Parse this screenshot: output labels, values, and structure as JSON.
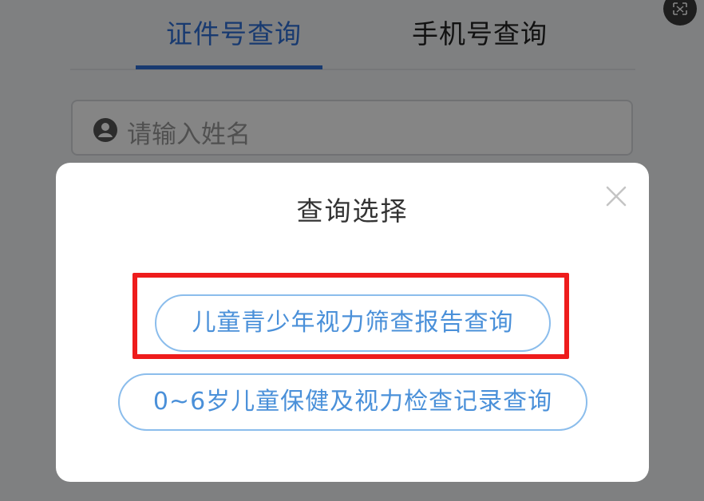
{
  "tabs": [
    {
      "label": "证件号查询",
      "active": true
    },
    {
      "label": "手机号查询",
      "active": false
    }
  ],
  "name_input": {
    "placeholder": "请输入姓名"
  },
  "modal": {
    "title": "查询选择",
    "options": [
      {
        "label": "儿童青少年视力筛查报告查询",
        "highlighted": true
      },
      {
        "label": "0~6岁儿童保健及视力检查记录查询",
        "highlighted": false
      }
    ]
  },
  "colors": {
    "accent": "#2f6fd6",
    "option_text": "#4a90d9",
    "option_border": "#8bbdec",
    "highlight": "#ee1c1c"
  },
  "icons": {
    "translate": "translate-icon",
    "user": "user-icon",
    "close": "close-icon"
  }
}
